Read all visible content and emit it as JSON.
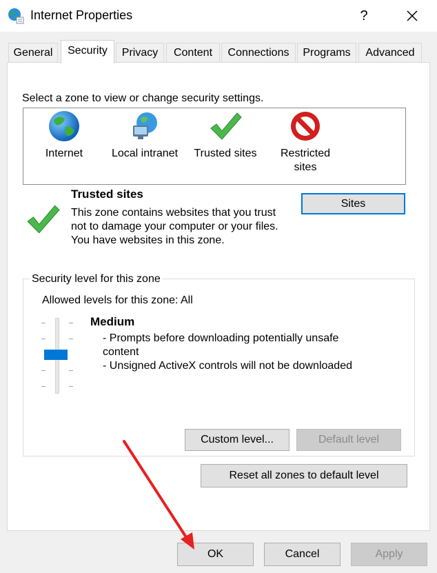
{
  "window": {
    "title": "Internet Properties",
    "help_glyph": "?",
    "close_glyph": "✕"
  },
  "tabs": [
    {
      "label": "General"
    },
    {
      "label": "Security",
      "active": true
    },
    {
      "label": "Privacy"
    },
    {
      "label": "Content"
    },
    {
      "label": "Connections"
    },
    {
      "label": "Programs"
    },
    {
      "label": "Advanced"
    }
  ],
  "security": {
    "zone_prompt": "Select a zone to view or change security settings.",
    "zones": [
      {
        "label": "Internet",
        "icon": "globe-icon"
      },
      {
        "label": "Local intranet",
        "icon": "network-globe-icon"
      },
      {
        "label": "Trusted sites",
        "icon": "green-check-icon",
        "selected": true
      },
      {
        "label": "Restricted sites",
        "icon": "no-entry-icon"
      }
    ],
    "selected_zone": {
      "name": "Trusted sites",
      "description": "This zone contains websites that you trust not to damage your computer or your files.",
      "status": "You have websites in this zone."
    },
    "sites_button": "Sites",
    "level_group_title": "Security level for this zone",
    "allowed_levels": "Allowed levels for this zone: All",
    "slider_level_fraction": 0.5,
    "level": {
      "name": "Medium",
      "bullets": "- Prompts before downloading potentially unsafe\n  content\n- Unsigned ActiveX controls will not be downloaded"
    },
    "custom_level_button": "Custom level...",
    "default_level_button": "Default level",
    "reset_button": "Reset all zones to default level"
  },
  "footer": {
    "ok": "OK",
    "cancel": "Cancel",
    "apply": "Apply"
  },
  "colors": {
    "accent": "#0078d7",
    "annotation_arrow": "#e8201f"
  }
}
